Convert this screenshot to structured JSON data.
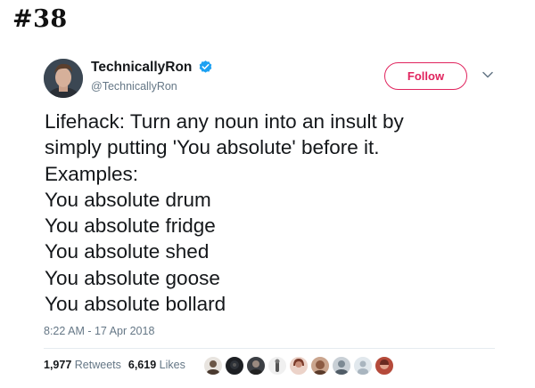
{
  "post_label": "#38",
  "tweet": {
    "display_name": "TechnicallyRon",
    "handle": "@TechnicallyRon",
    "follow_label": "Follow",
    "lines": [
      "Lifehack: Turn any noun into an insult by",
      "simply putting 'You absolute' before it.",
      "Examples:",
      "You absolute drum",
      "You absolute fridge",
      "You absolute shed",
      "You absolute goose",
      "You absolute bollard"
    ],
    "timestamp": "8:22 AM - 17 Apr 2018",
    "retweets_count": "1,977",
    "retweets_label": "Retweets",
    "likes_count": "6,619",
    "likes_label": "Likes"
  },
  "colors": {
    "follow_accent": "#e0245e",
    "verified": "#1da1f2",
    "secondary_text": "#657786"
  },
  "icons": [
    "verified-badge-icon",
    "chevron-down-icon"
  ]
}
